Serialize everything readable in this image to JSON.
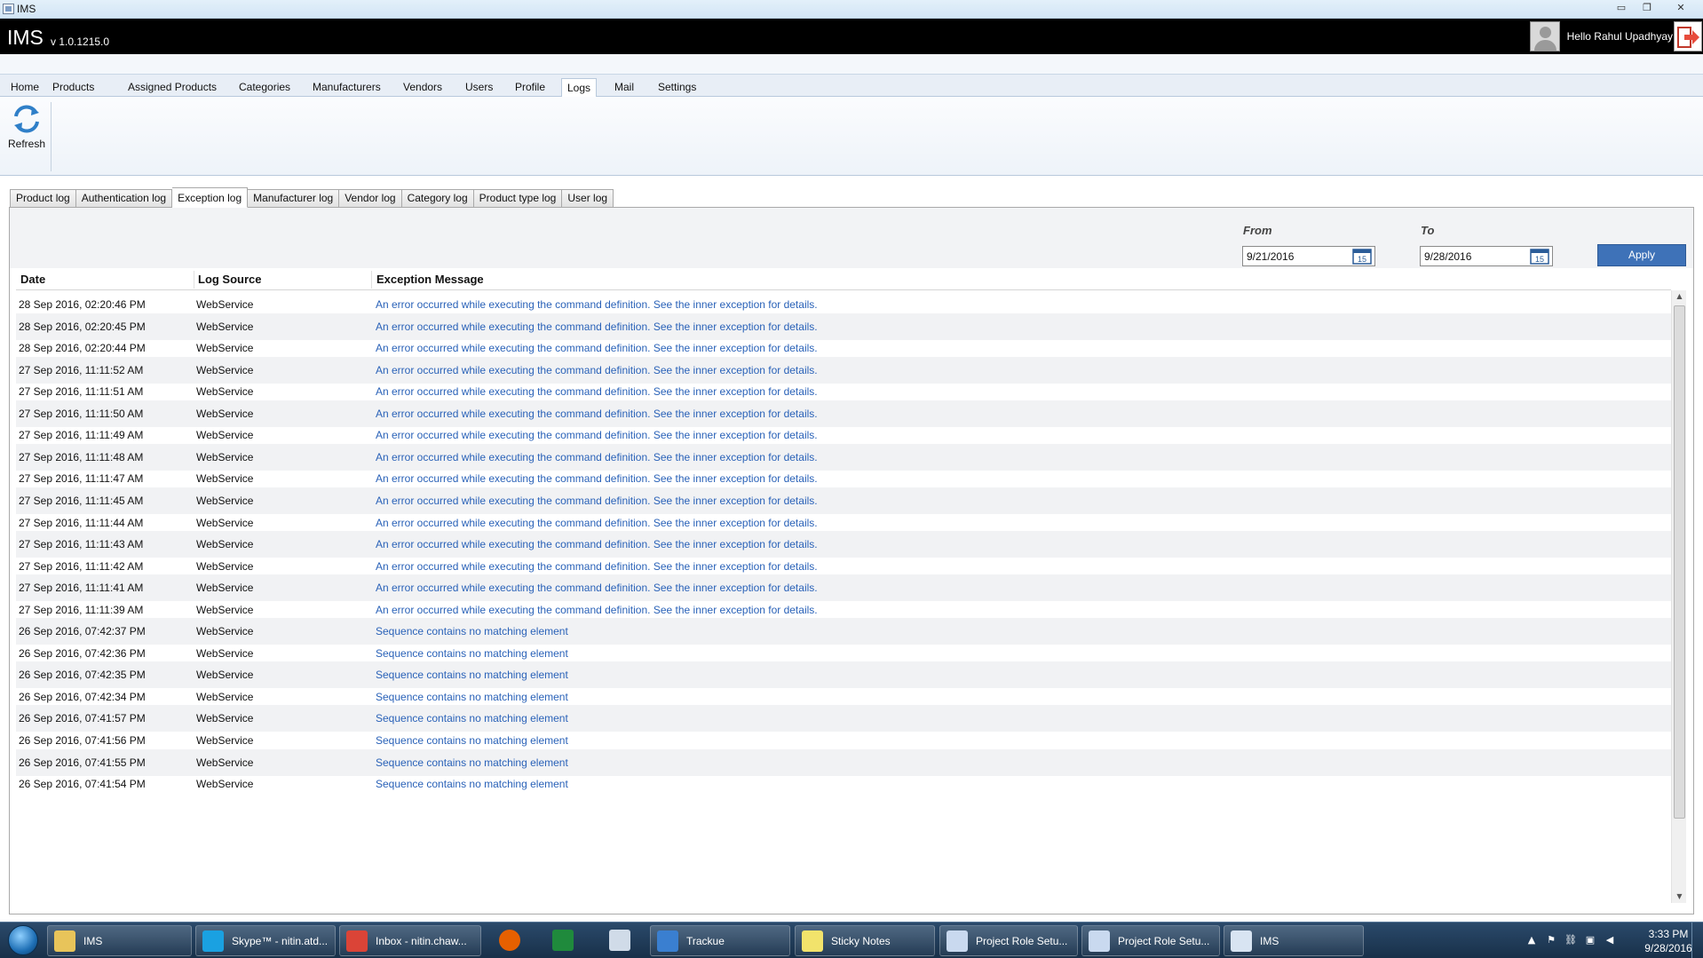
{
  "window": {
    "title": "IMS",
    "min_glyph": "▭",
    "max_glyph": "❐",
    "close_glyph": "✕"
  },
  "header": {
    "brand": "IMS",
    "version": "v 1.0.1215.0",
    "greeting": "Hello Rahul Upadhyay"
  },
  "menu": [
    "Home",
    "Products",
    "Assigned Products",
    "Categories",
    "Manufacturers",
    "Vendors",
    "Users",
    "Profile",
    "Logs",
    "Mail",
    "Settings"
  ],
  "menu_active": "Logs",
  "ribbon": {
    "refresh_label": "Refresh"
  },
  "subtabs": [
    "Product log",
    "Authentication log",
    "Exception log",
    "Manufacturer log",
    "Vendor log",
    "Category log",
    "Product type log",
    "User log"
  ],
  "subtab_active": "Exception log",
  "filter": {
    "from_label": "From",
    "to_label": "To",
    "from_value": "9/21/2016",
    "to_value": "9/28/2016",
    "cal_day": "15",
    "apply_label": "Apply"
  },
  "grid": {
    "columns": [
      "Date",
      "Log Source",
      "Exception Message"
    ],
    "rows": [
      [
        "28 Sep 2016, 02:20:46 PM",
        "WebService",
        "An error occurred while executing the command definition. See the inner exception for details."
      ],
      [
        "28 Sep 2016, 02:20:45 PM",
        "WebService",
        "An error occurred while executing the command definition. See the inner exception for details."
      ],
      [
        "28 Sep 2016, 02:20:44 PM",
        "WebService",
        "An error occurred while executing the command definition. See the inner exception for details."
      ],
      [
        "27 Sep 2016, 11:11:52 AM",
        "WebService",
        "An error occurred while executing the command definition. See the inner exception for details."
      ],
      [
        "27 Sep 2016, 11:11:51 AM",
        "WebService",
        "An error occurred while executing the command definition. See the inner exception for details."
      ],
      [
        "27 Sep 2016, 11:11:50 AM",
        "WebService",
        "An error occurred while executing the command definition. See the inner exception for details."
      ],
      [
        "27 Sep 2016, 11:11:49 AM",
        "WebService",
        "An error occurred while executing the command definition. See the inner exception for details."
      ],
      [
        "27 Sep 2016, 11:11:48 AM",
        "WebService",
        "An error occurred while executing the command definition. See the inner exception for details."
      ],
      [
        "27 Sep 2016, 11:11:47 AM",
        "WebService",
        "An error occurred while executing the command definition. See the inner exception for details."
      ],
      [
        "27 Sep 2016, 11:11:45 AM",
        "WebService",
        "An error occurred while executing the command definition. See the inner exception for details."
      ],
      [
        "27 Sep 2016, 11:11:44 AM",
        "WebService",
        "An error occurred while executing the command definition. See the inner exception for details."
      ],
      [
        "27 Sep 2016, 11:11:43 AM",
        "WebService",
        "An error occurred while executing the command definition. See the inner exception for details."
      ],
      [
        "27 Sep 2016, 11:11:42 AM",
        "WebService",
        "An error occurred while executing the command definition. See the inner exception for details."
      ],
      [
        "27 Sep 2016, 11:11:41 AM",
        "WebService",
        "An error occurred while executing the command definition. See the inner exception for details."
      ],
      [
        "27 Sep 2016, 11:11:39 AM",
        "WebService",
        "An error occurred while executing the command definition. See the inner exception for details."
      ],
      [
        "26 Sep 2016, 07:42:37 PM",
        "WebService",
        "Sequence contains no matching element"
      ],
      [
        "26 Sep 2016, 07:42:36 PM",
        "WebService",
        "Sequence contains no matching element"
      ],
      [
        "26 Sep 2016, 07:42:35 PM",
        "WebService",
        "Sequence contains no matching element"
      ],
      [
        "26 Sep 2016, 07:42:34 PM",
        "WebService",
        "Sequence contains no matching element"
      ],
      [
        "26 Sep 2016, 07:41:57 PM",
        "WebService",
        "Sequence contains no matching element"
      ],
      [
        "26 Sep 2016, 07:41:56 PM",
        "WebService",
        "Sequence contains no matching element"
      ],
      [
        "26 Sep 2016, 07:41:55 PM",
        "WebService",
        "Sequence contains no matching element"
      ],
      [
        "26 Sep 2016, 07:41:54 PM",
        "WebService",
        "Sequence contains no matching element"
      ]
    ]
  },
  "taskbar": {
    "items": [
      {
        "label": "IMS",
        "icon": "folder-icon",
        "color": "#e8c45a"
      },
      {
        "label": "Skype™ - nitin.atd...",
        "icon": "skype-icon",
        "color": "#1aa1e1"
      },
      {
        "label": "Inbox - nitin.chaw...",
        "icon": "chrome-icon",
        "color": "#db4437"
      },
      {
        "label": "Trackue",
        "icon": "check-icon",
        "color": "#3a7fd0"
      },
      {
        "label": "Sticky Notes",
        "icon": "sticky-notes-icon",
        "color": "#f2e36b"
      },
      {
        "label": "Project Role Setu...",
        "icon": "document-icon",
        "color": "#c9d9ef"
      },
      {
        "label": "Project Role Setu...",
        "icon": "document-icon",
        "color": "#c9d9ef"
      },
      {
        "label": "IMS",
        "icon": "ims-window-icon",
        "color": "#d8e4f2"
      }
    ],
    "pinned": [
      {
        "icon": "firefox-icon",
        "color": "#e66000"
      },
      {
        "icon": "spreadsheet-icon",
        "color": "#1f8a3c"
      },
      {
        "icon": "office-icon",
        "color": "#d0dbe8"
      }
    ],
    "tray": {
      "up_glyph": "▲",
      "flag_glyph": "⚑",
      "usb_glyph": "⛓",
      "net_glyph": "▣",
      "volume_glyph": "◀",
      "time": "3:33 PM",
      "date": "9/28/2016"
    }
  },
  "colors": {
    "accent": "#3e72b8",
    "link": "#2a62b8",
    "header_bg": "#000000"
  }
}
